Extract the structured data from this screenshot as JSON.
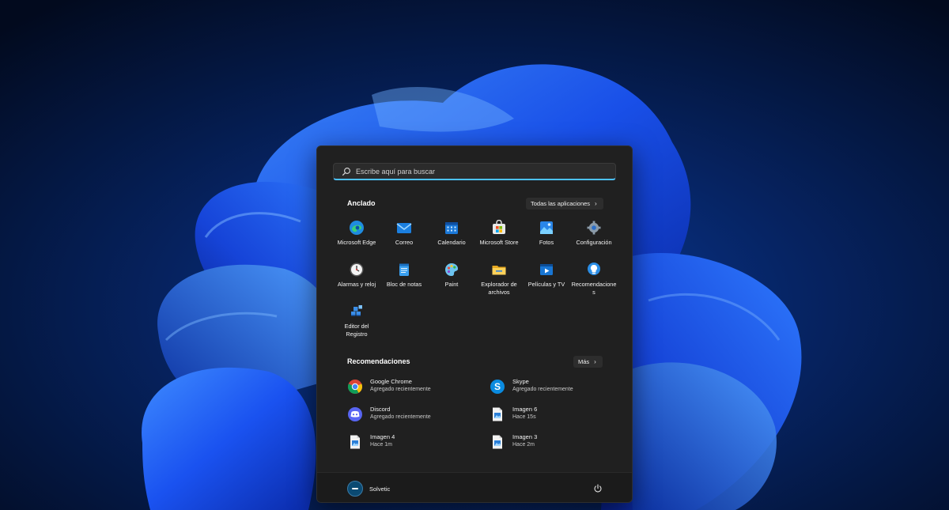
{
  "search": {
    "placeholder": "Escribe aquí para buscar"
  },
  "pinned": {
    "title": "Anclado",
    "all_apps_label": "Todas las aplicaciones",
    "apps": [
      {
        "label": "Microsoft Edge",
        "icon": "edge-icon"
      },
      {
        "label": "Correo",
        "icon": "mail-icon"
      },
      {
        "label": "Calendario",
        "icon": "calendar-icon"
      },
      {
        "label": "Microsoft Store",
        "icon": "store-icon"
      },
      {
        "label": "Fotos",
        "icon": "photos-icon"
      },
      {
        "label": "Configuración",
        "icon": "settings-gear-icon"
      },
      {
        "label": "Alarmas y reloj",
        "icon": "clock-icon"
      },
      {
        "label": "Bloc de notas",
        "icon": "notepad-icon"
      },
      {
        "label": "Paint",
        "icon": "paint-palette-icon"
      },
      {
        "label": "Explorador de archivos",
        "icon": "folder-icon"
      },
      {
        "label": "Películas y TV",
        "icon": "movies-tv-icon"
      },
      {
        "label": "Recomendaciones",
        "icon": "tips-bulb-icon"
      },
      {
        "label": "Editor del Registro",
        "icon": "registry-cubes-icon"
      }
    ]
  },
  "recommended": {
    "title": "Recomendaciones",
    "more_label": "Más",
    "items": [
      {
        "name": "Google Chrome",
        "sub": "Agregado recientemente",
        "icon": "chrome-icon"
      },
      {
        "name": "Skype",
        "sub": "Agregado recientemente",
        "icon": "skype-icon"
      },
      {
        "name": "Discord",
        "sub": "Agregado recientemente",
        "icon": "discord-icon"
      },
      {
        "name": "Imagen 6",
        "sub": "Hace 15s",
        "icon": "image-file-icon"
      },
      {
        "name": "Imagen 4",
        "sub": "Hace 1m",
        "icon": "image-file-icon"
      },
      {
        "name": "Imagen 3",
        "sub": "Hace 2m",
        "icon": "image-file-icon"
      }
    ]
  },
  "footer": {
    "user_name": "Solvetic"
  },
  "colors": {
    "accent": "#4cc2ff",
    "menu_bg": "#202020",
    "footer_bg": "#1b1b1b"
  }
}
